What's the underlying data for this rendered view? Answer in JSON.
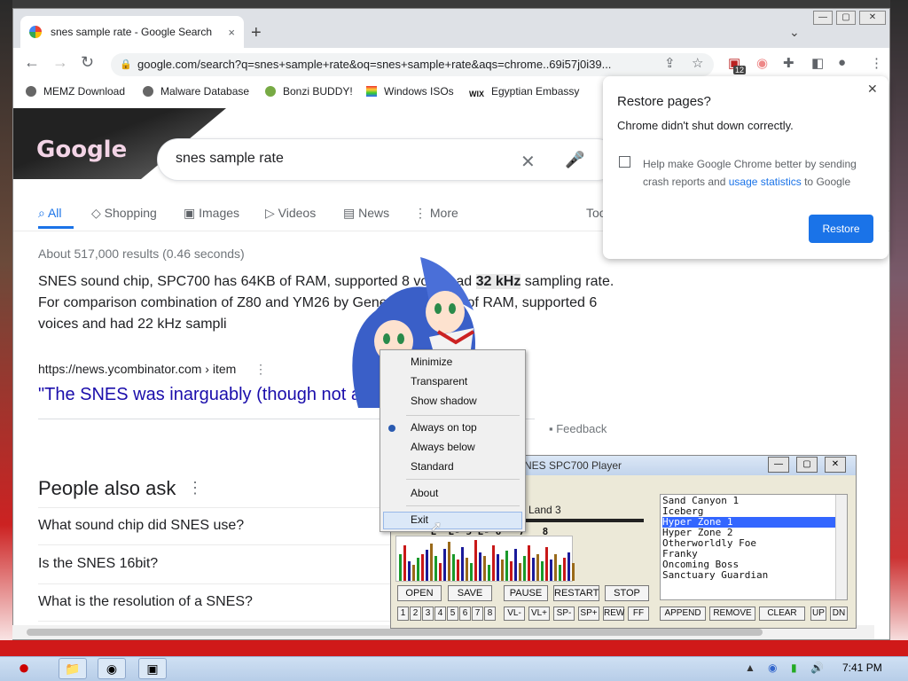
{
  "browser": {
    "tab_title": "snes sample rate - Google Search",
    "tab_close": "×",
    "new_tab": "+",
    "window": {
      "minimize": "—",
      "maximize": "▢",
      "close": "✕",
      "tab_search": "⌄"
    },
    "url": "google.com/search?q=snes+sample+rate&oq=snes+sample+rate&aqs=chrome..69i57j0i39...",
    "nav": {
      "back": "←",
      "forward": "→",
      "reload": "↻"
    },
    "extension_badge": "12",
    "bookmarks": [
      "MEMZ Download",
      "Malware Database",
      "Bonzi BUDDY!",
      "Windows ISOs",
      "Egyptian Embassy"
    ]
  },
  "search": {
    "logo": "Google",
    "query": "snes sample rate",
    "tabs": [
      {
        "label": "All"
      },
      {
        "label": "Shopping"
      },
      {
        "label": "Images"
      },
      {
        "label": "Videos"
      },
      {
        "label": "News"
      },
      {
        "label": "More"
      },
      {
        "label": "Too"
      }
    ],
    "stats": "About 517,000 results (0.46 seconds)",
    "snippet_1": "SNES sound chip, SPC700 has 64KB of RAM, supported 8 vo",
    "snippet_mid": "ed had ",
    "snippet_bold": "32 kHz",
    "snippet_2": " sampling rate. For comparison combination of Z80 and YM26",
    "snippet_3": " by Genesis had 8KB of RAM, supported 6 voices and had 22 kHz sampli",
    "cite": "https://news.ycombinator.com › item",
    "result_title": "\"The SNES was inarguably (though not a",
    "feedback": "Feedback",
    "paa_title": "People also ask",
    "questions": [
      "What sound chip did SNES use?",
      "Is the SNES 16bit?",
      "What is the resolution of a SNES?"
    ]
  },
  "restore": {
    "title": "Restore pages?",
    "message": "Chrome didn't shut down correctly.",
    "help_text": "Help make Google Chrome better by sending crash reports and ",
    "help_link": "usage statistics",
    "help_end": " to Google",
    "button": "Restore",
    "close": "✕"
  },
  "spc": {
    "title": "NES SPC700 Player",
    "track": "Land 3",
    "channel_labels": "      E  E- 5 E- 6   7   8",
    "playlist": [
      "Sand Canyon 1",
      "Iceberg",
      "Hyper Zone 1",
      "Hyper Zone 2",
      "Otherworldly Foe",
      "Franky",
      "Oncoming Boss",
      "Sanctuary Guardian"
    ],
    "selected_index": 2,
    "play_buttons": [
      "OPEN",
      "SAVE",
      "PAUSE",
      "RESTART",
      "STOP"
    ],
    "channels": [
      "1",
      "2",
      "3",
      "4",
      "5",
      "6",
      "7",
      "8"
    ],
    "vol_buttons": [
      "VL-",
      "VL+",
      "SP-",
      "SP+",
      "REW",
      "FF"
    ],
    "list_buttons": [
      "APPEND",
      "REMOVE",
      "CLEAR",
      "UP",
      "DN"
    ],
    "min": "—",
    "max": "▢",
    "close": "✕"
  },
  "context_menu": {
    "items": [
      "Minimize",
      "Transparent",
      "Show shadow",
      "Always on top",
      "Always below",
      "Standard",
      "About",
      "Exit"
    ]
  },
  "taskbar": {
    "clock": "7:41 PM",
    "start_icon": "angry-bird-icon"
  },
  "colors": {
    "accent": "#1a73e8",
    "link": "#1a0dab",
    "taskbar": "#b7cde8",
    "selection": "#3366ff"
  }
}
